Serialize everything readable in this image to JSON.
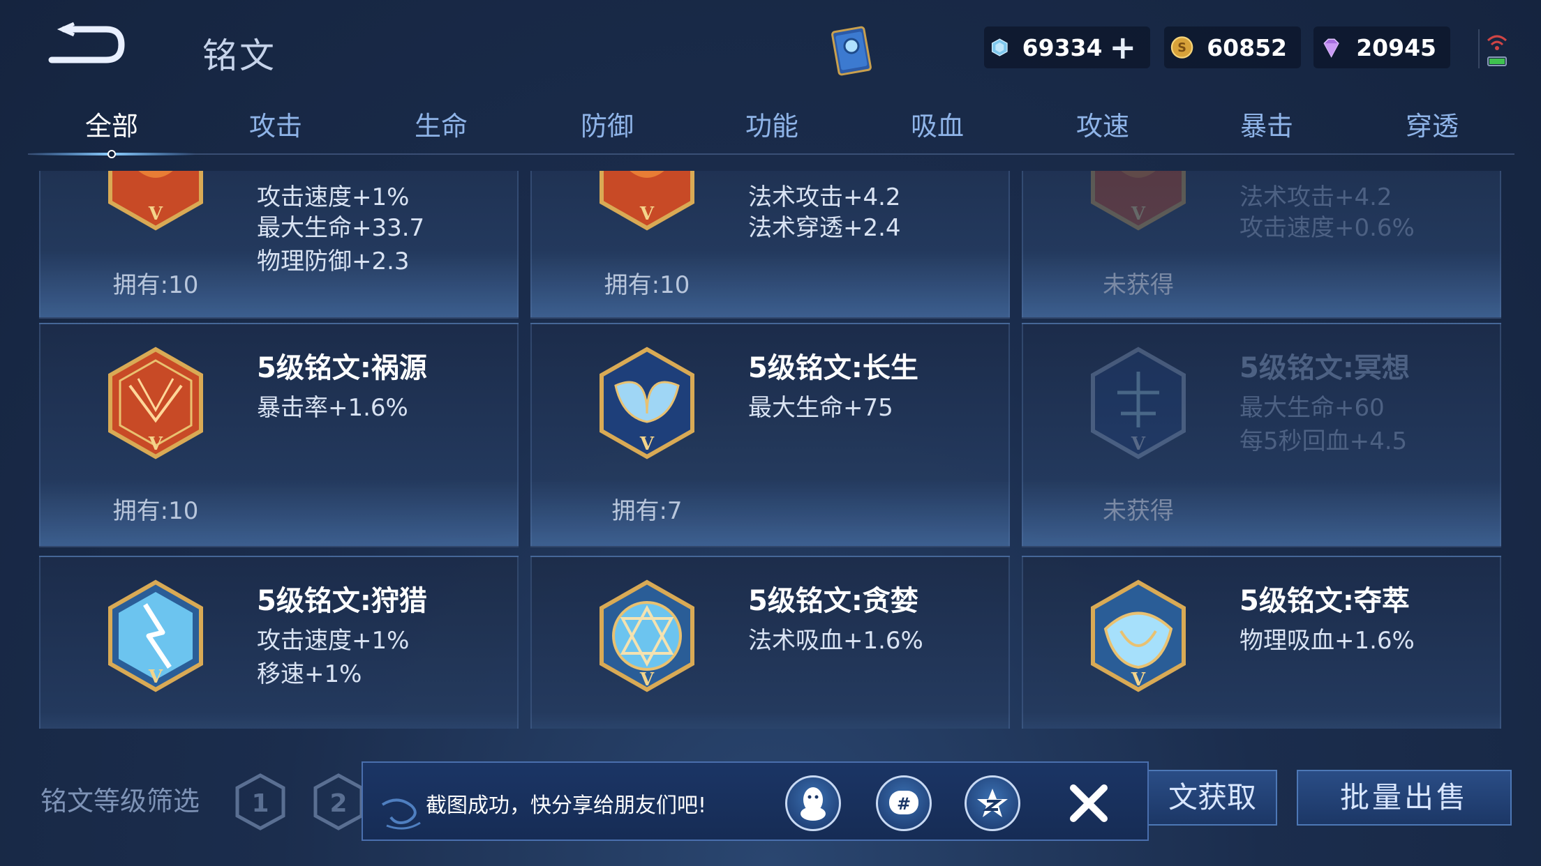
{
  "header": {
    "title": "铭文",
    "currencies": [
      {
        "name": "diamond-coupon",
        "icon": "crystal-icon",
        "amount": "69334",
        "has_plus": true
      },
      {
        "name": "gold",
        "icon": "gold-coin-icon",
        "amount": "60852"
      },
      {
        "name": "gem",
        "icon": "purple-gem-icon",
        "amount": "20945"
      }
    ]
  },
  "tabs": [
    "全部",
    "攻击",
    "生命",
    "防御",
    "功能",
    "吸血",
    "攻速",
    "暴击",
    "穿透"
  ],
  "active_tab": 0,
  "cards_top_row": [
    {
      "lines": [
        "攻击速度+1%",
        "最大生命+33.7",
        "物理防御+2.3"
      ],
      "owned": "拥有:10",
      "color": "red"
    },
    {
      "lines": [
        "法术攻击+4.2",
        "法术穿透+2.4"
      ],
      "owned": "拥有:10",
      "color": "red"
    },
    {
      "lines": [
        "法术攻击+4.2",
        "攻击速度+0.6%"
      ],
      "owned": "未获得",
      "color": "red",
      "dim": true
    }
  ],
  "cards_mid_row": [
    {
      "name": "5级铭文:祸源",
      "lines": [
        "暴击率+1.6%"
      ],
      "owned": "拥有:10",
      "color": "red"
    },
    {
      "name": "5级铭文:长生",
      "lines": [
        "最大生命+75"
      ],
      "owned": "拥有:7",
      "color": "blue"
    },
    {
      "name": "5级铭文:冥想",
      "lines": [
        "最大生命+60",
        "每5秒回血+4.5"
      ],
      "owned": "未获得",
      "color": "blue",
      "dim": true
    }
  ],
  "cards_bottom_row": [
    {
      "name": "5级铭文:狩猎",
      "lines": [
        "攻击速度+1%",
        "移速+1%"
      ],
      "color": "cyan"
    },
    {
      "name": "5级铭文:贪婪",
      "lines": [
        "法术吸血+1.6%"
      ],
      "color": "cyan"
    },
    {
      "name": "5级铭文:夺萃",
      "lines": [
        "物理吸血+1.6%"
      ],
      "color": "cyan"
    }
  ],
  "footer": {
    "filter_label": "铭文等级筛选",
    "level_buttons": [
      "1",
      "2"
    ],
    "obtain_label": "文获取",
    "sell_label": "批量出售"
  },
  "toast": {
    "message": "截图成功，快分享给朋友们吧!",
    "share_icons": [
      "qq-penguin-icon",
      "wechat-moments-icon",
      "qzone-star-icon"
    ]
  },
  "colors": {
    "tab_active": "#ffffff",
    "tab_inactive": "#8fb4e8",
    "card_text": "#d9e3f3",
    "gold_trim": "#c9a04e"
  }
}
